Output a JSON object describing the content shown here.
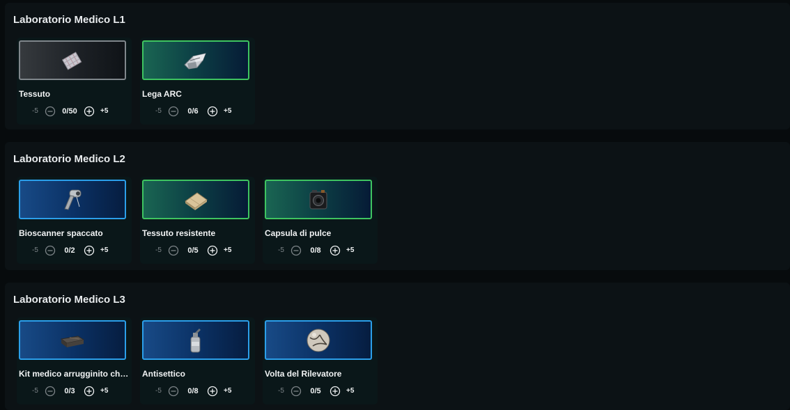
{
  "sections": [
    {
      "title": "Laboratorio Medico L1",
      "items": [
        {
          "name": "Tessuto",
          "count": "0/50",
          "minus_label": "-5",
          "plus_label": "+5",
          "rarity": "common",
          "icon": "fabric-icon"
        },
        {
          "name": "Lega ARC",
          "count": "0/6",
          "minus_label": "-5",
          "plus_label": "+5",
          "rarity": "uncommon",
          "icon": "arc-alloy-icon"
        }
      ]
    },
    {
      "title": "Laboratorio Medico L2",
      "items": [
        {
          "name": "Bioscanner spaccato",
          "count": "0/2",
          "minus_label": "-5",
          "plus_label": "+5",
          "rarity": "rare",
          "icon": "bioscanner-icon"
        },
        {
          "name": "Tessuto resistente",
          "count": "0/5",
          "minus_label": "-5",
          "plus_label": "+5",
          "rarity": "uncommon",
          "icon": "durable-cloth-icon"
        },
        {
          "name": "Capsula di pulce",
          "count": "0/8",
          "minus_label": "-5",
          "plus_label": "+5",
          "rarity": "uncommon",
          "icon": "flea-capsule-icon"
        }
      ]
    },
    {
      "title": "Laboratorio Medico L3",
      "items": [
        {
          "name": "Kit medico arrugginito chi...",
          "count": "0/3",
          "minus_label": "-5",
          "plus_label": "+5",
          "rarity": "rare",
          "icon": "rusted-medkit-icon"
        },
        {
          "name": "Antisettico",
          "count": "0/8",
          "minus_label": "-5",
          "plus_label": "+5",
          "rarity": "rare",
          "icon": "antiseptic-bottle-icon"
        },
        {
          "name": "Volta del Rilevatore",
          "count": "0/5",
          "minus_label": "-5",
          "plus_label": "+5",
          "rarity": "rare",
          "icon": "surveyor-vault-icon"
        }
      ]
    }
  ],
  "colors": {
    "common": "#80878c",
    "uncommon": "#3ec460",
    "rare": "#2b9fea",
    "panel": "#0c1215",
    "background": "#070b0d"
  }
}
